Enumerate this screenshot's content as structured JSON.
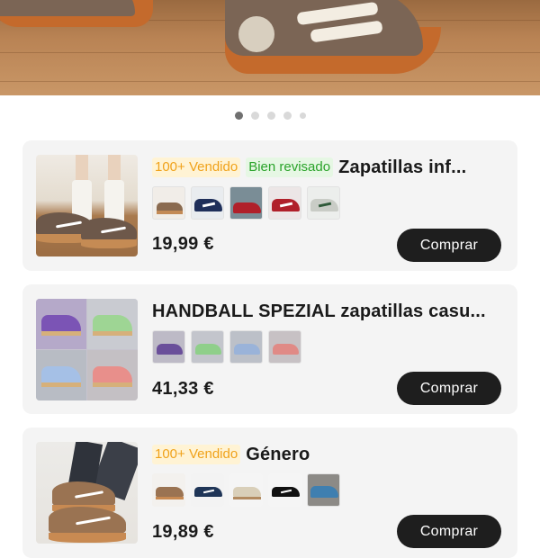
{
  "carousel": {
    "dot_count": 5,
    "active_index": 0
  },
  "products": [
    {
      "badges": [
        {
          "text": "100+ Vendido",
          "kind": "sold"
        },
        {
          "text": "Bien revisado",
          "kind": "reviewed"
        }
      ],
      "title": "Zapatillas inf...",
      "price": "19,99 €",
      "buy_label": "Comprar",
      "swatch_colors": [
        "#8a6a4f",
        "#1f2f5a",
        "#5a7a8a",
        "#b0202a",
        "#c9ccc6"
      ]
    },
    {
      "badges": [],
      "title": "HANDBALL SPEZIAL zapatillas casu...",
      "price": "41,33 €",
      "buy_label": "Comprar",
      "swatch_colors": [
        "#6a4f9a",
        "#8fcf8a",
        "#9ab3d9",
        "#e08a86"
      ]
    },
    {
      "badges": [
        {
          "text": "100+ Vendido",
          "kind": "sold"
        }
      ],
      "title": "Género",
      "price": "19,89 €",
      "buy_label": "Comprar",
      "swatch_colors": [
        "#9a7352",
        "#1f3557",
        "#d9cfb9",
        "#111111",
        "#3f7fb0"
      ]
    }
  ]
}
